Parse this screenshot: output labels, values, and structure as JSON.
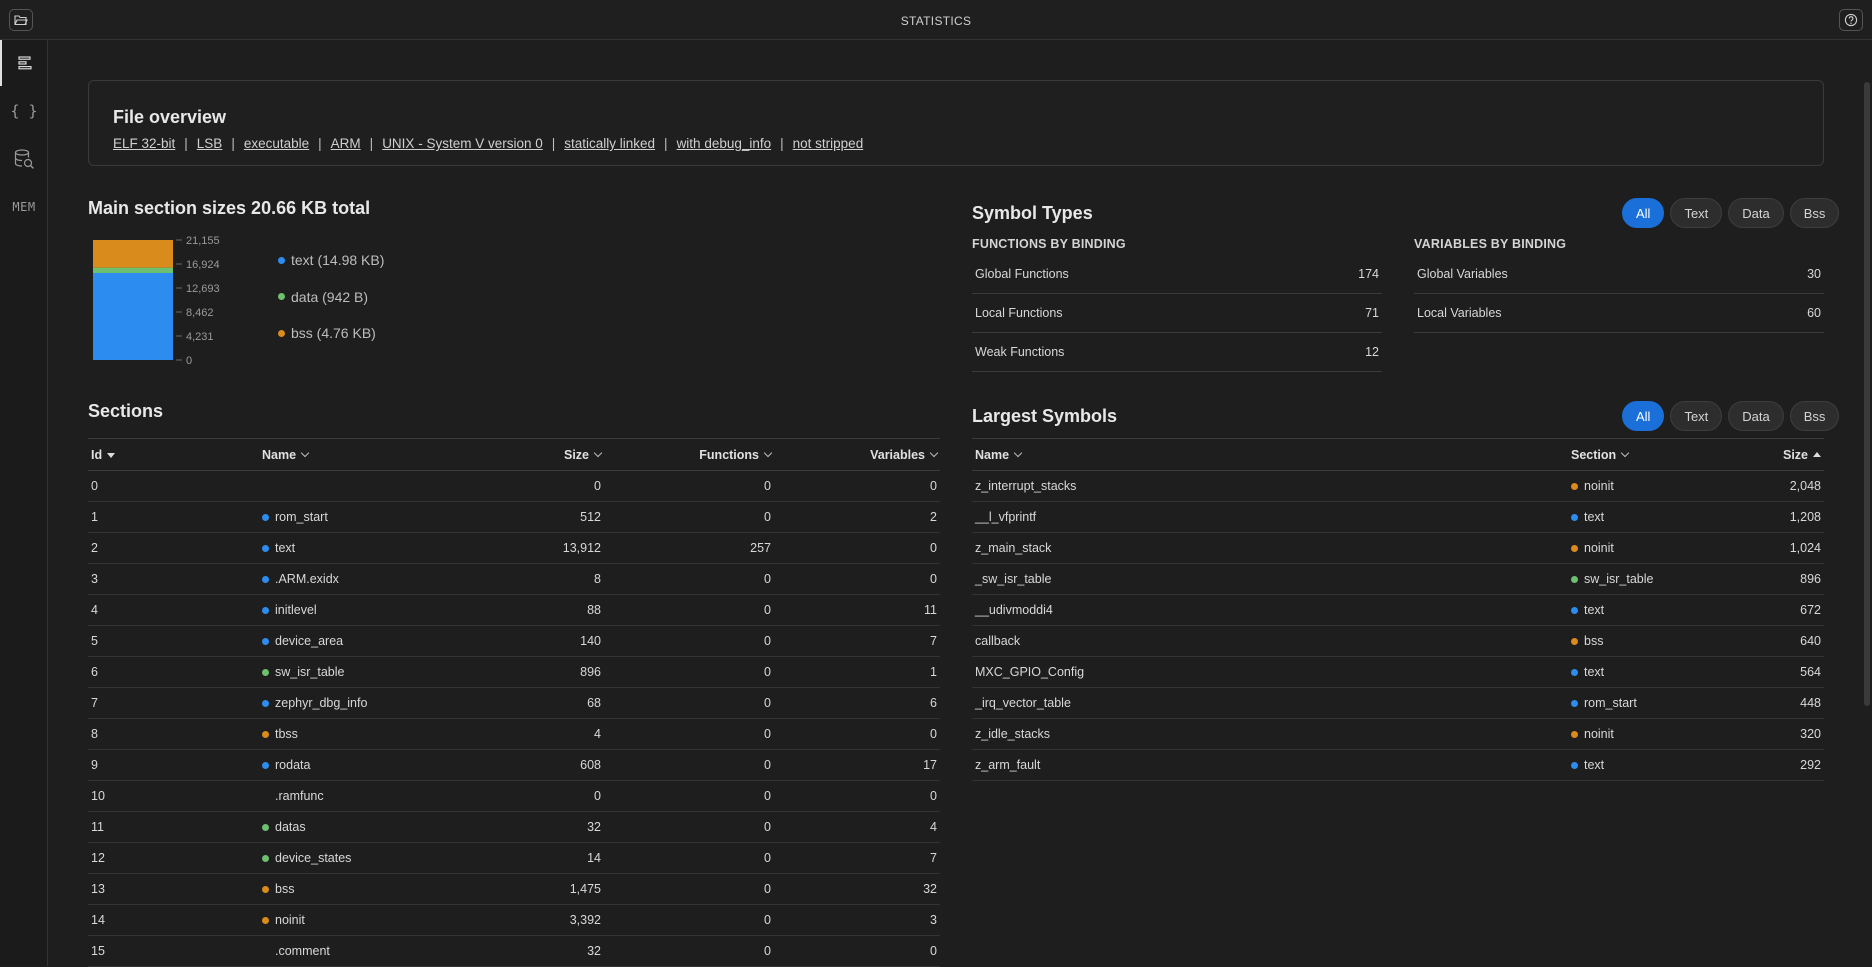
{
  "window": {
    "title": "STATISTICS"
  },
  "sidebar": {
    "items": [
      {
        "name": "sidebar-item-statistics",
        "icon": "align-left-icon",
        "label": ""
      },
      {
        "name": "sidebar-item-symbols",
        "icon": "braces-icon",
        "label": "{ }"
      },
      {
        "name": "sidebar-item-database",
        "icon": "database-search-icon",
        "label": ""
      },
      {
        "name": "sidebar-item-mem",
        "icon": "mem-text-icon",
        "label": "MEM"
      }
    ]
  },
  "overview": {
    "title": "File overview",
    "tags": [
      "ELF 32-bit",
      "LSB",
      "executable",
      "ARM",
      "UNIX - System V version 0",
      "statically linked",
      "with debug_info",
      "not stripped"
    ],
    "separator": "|"
  },
  "section_sizes": {
    "title": "Main section sizes 20.66 KB total",
    "legend": [
      {
        "label": "text (14.98 KB)",
        "color": "#2d8cf0"
      },
      {
        "label": "data (942 B)",
        "color": "#6cc070"
      },
      {
        "label": "bss (4.76 KB)",
        "color": "#d98b1c"
      }
    ]
  },
  "chart_data": {
    "type": "bar",
    "stacked": true,
    "categories": [
      "total"
    ],
    "series": [
      {
        "name": "text (14.98 KB)",
        "values": [
          15340
        ],
        "color": "#2d8cf0"
      },
      {
        "name": "data (942 B)",
        "values": [
          942
        ],
        "color": "#6cc070"
      },
      {
        "name": "bss (4.76 KB)",
        "values": [
          4874
        ],
        "color": "#d98b1c"
      }
    ],
    "yticks": [
      "0",
      "4,231",
      "8,462",
      "12,693",
      "16,924",
      "21,155"
    ],
    "ylim": [
      0,
      21155
    ],
    "title": "",
    "xlabel": "",
    "ylabel": "",
    "legend_position": "right",
    "grid": false
  },
  "symbol_types": {
    "title": "Symbol Types",
    "filters": [
      "All",
      "Text",
      "Data",
      "Bss"
    ],
    "active_filter": "All",
    "functions_heading": "FUNCTIONS BY BINDING",
    "functions": [
      {
        "label": "Global Functions",
        "value": "174"
      },
      {
        "label": "Local Functions",
        "value": "71"
      },
      {
        "label": "Weak Functions",
        "value": "12"
      }
    ],
    "variables_heading": "VARIABLES BY BINDING",
    "variables": [
      {
        "label": "Global Variables",
        "value": "30"
      },
      {
        "label": "Local Variables",
        "value": "60"
      }
    ]
  },
  "sections": {
    "title": "Sections",
    "headers": {
      "id": "Id",
      "name": "Name",
      "size": "Size",
      "functions": "Functions",
      "variables": "Variables"
    },
    "rows": [
      {
        "id": "0",
        "name": "",
        "dot": "",
        "size": "0",
        "functions": "0",
        "variables": "0"
      },
      {
        "id": "1",
        "name": "rom_start",
        "dot": "#2d8cf0",
        "size": "512",
        "functions": "0",
        "variables": "2"
      },
      {
        "id": "2",
        "name": "text",
        "dot": "#2d8cf0",
        "size": "13,912",
        "functions": "257",
        "variables": "0"
      },
      {
        "id": "3",
        "name": ".ARM.exidx",
        "dot": "#2d8cf0",
        "size": "8",
        "functions": "0",
        "variables": "0"
      },
      {
        "id": "4",
        "name": "initlevel",
        "dot": "#2d8cf0",
        "size": "88",
        "functions": "0",
        "variables": "11"
      },
      {
        "id": "5",
        "name": "device_area",
        "dot": "#2d8cf0",
        "size": "140",
        "functions": "0",
        "variables": "7"
      },
      {
        "id": "6",
        "name": "sw_isr_table",
        "dot": "#6cc070",
        "size": "896",
        "functions": "0",
        "variables": "1"
      },
      {
        "id": "7",
        "name": "zephyr_dbg_info",
        "dot": "#2d8cf0",
        "size": "68",
        "functions": "0",
        "variables": "6"
      },
      {
        "id": "8",
        "name": "tbss",
        "dot": "#d98b1c",
        "size": "4",
        "functions": "0",
        "variables": "0"
      },
      {
        "id": "9",
        "name": "rodata",
        "dot": "#2d8cf0",
        "size": "608",
        "functions": "0",
        "variables": "17"
      },
      {
        "id": "10",
        "name": ".ramfunc",
        "dot": "",
        "size": "0",
        "functions": "0",
        "variables": "0"
      },
      {
        "id": "11",
        "name": "datas",
        "dot": "#6cc070",
        "size": "32",
        "functions": "0",
        "variables": "4"
      },
      {
        "id": "12",
        "name": "device_states",
        "dot": "#6cc070",
        "size": "14",
        "functions": "0",
        "variables": "7"
      },
      {
        "id": "13",
        "name": "bss",
        "dot": "#d98b1c",
        "size": "1,475",
        "functions": "0",
        "variables": "32"
      },
      {
        "id": "14",
        "name": "noinit",
        "dot": "#d98b1c",
        "size": "3,392",
        "functions": "0",
        "variables": "3"
      },
      {
        "id": "15",
        "name": ".comment",
        "dot": "",
        "size": "32",
        "functions": "0",
        "variables": "0"
      }
    ]
  },
  "largest_symbols": {
    "title": "Largest Symbols",
    "filters": [
      "All",
      "Text",
      "Data",
      "Bss"
    ],
    "active_filter": "All",
    "headers": {
      "name": "Name",
      "section": "Section",
      "size": "Size"
    },
    "rows": [
      {
        "name": "z_interrupt_stacks",
        "section": "noinit",
        "dot": "#d98b1c",
        "size": "2,048"
      },
      {
        "name": "__l_vfprintf",
        "section": "text",
        "dot": "#2d8cf0",
        "size": "1,208"
      },
      {
        "name": "z_main_stack",
        "section": "noinit",
        "dot": "#d98b1c",
        "size": "1,024"
      },
      {
        "name": "_sw_isr_table",
        "section": "sw_isr_table",
        "dot": "#6cc070",
        "size": "896"
      },
      {
        "name": "__udivmoddi4",
        "section": "text",
        "dot": "#2d8cf0",
        "size": "672"
      },
      {
        "name": "callback",
        "section": "bss",
        "dot": "#d98b1c",
        "size": "640"
      },
      {
        "name": "MXC_GPIO_Config",
        "section": "text",
        "dot": "#2d8cf0",
        "size": "564"
      },
      {
        "name": "_irq_vector_table",
        "section": "rom_start",
        "dot": "#2d8cf0",
        "size": "448"
      },
      {
        "name": "z_idle_stacks",
        "section": "noinit",
        "dot": "#d98b1c",
        "size": "320"
      },
      {
        "name": "z_arm_fault",
        "section": "text",
        "dot": "#2d8cf0",
        "size": "292"
      }
    ]
  }
}
